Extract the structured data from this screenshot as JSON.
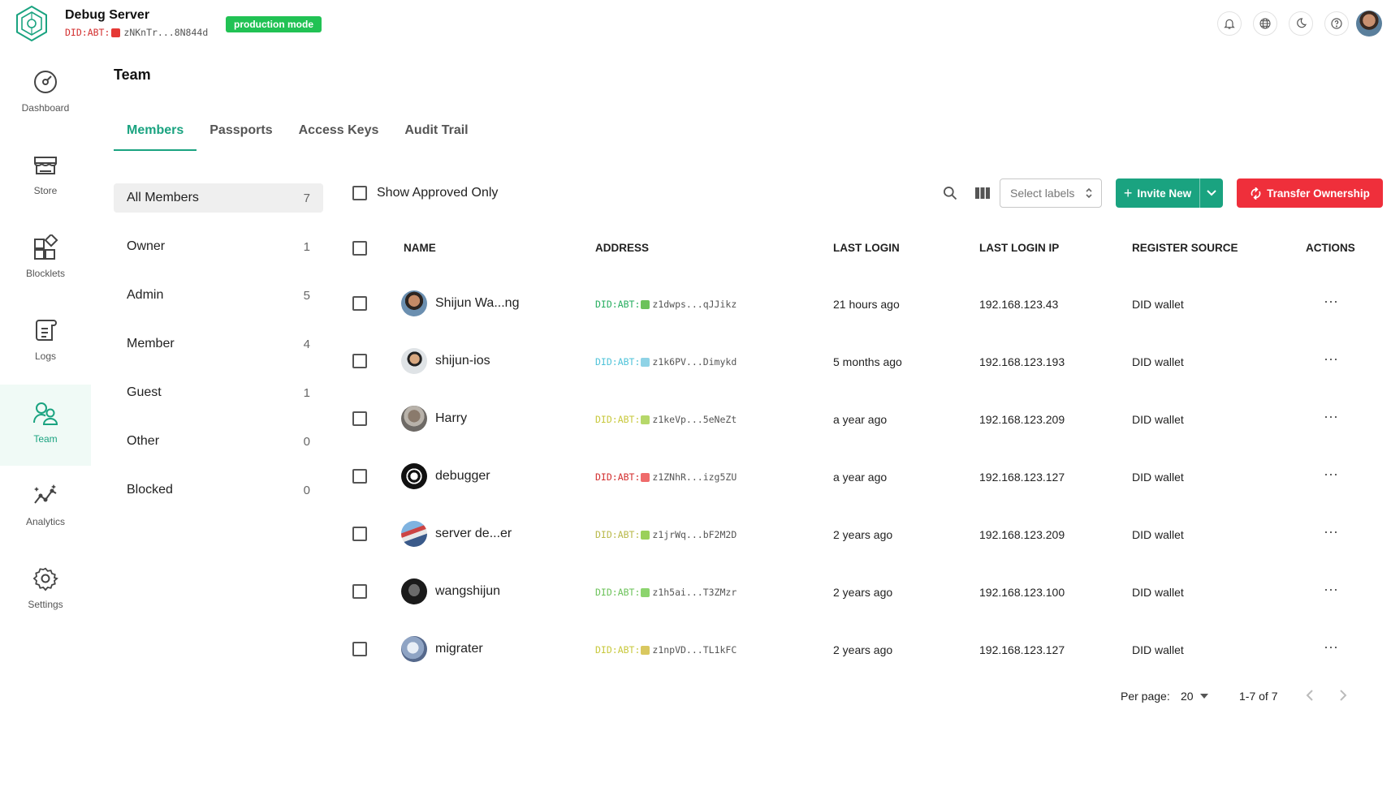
{
  "header": {
    "server_name": "Debug Server",
    "did_prefix": "DID:ABT:",
    "did_address": "zNKnTr...8N844d",
    "mode_badge": "production mode",
    "icons": [
      "bell-icon",
      "globe-icon",
      "moon-icon",
      "help-icon",
      "avatar"
    ]
  },
  "sidebar": {
    "items": [
      {
        "label": "Dashboard",
        "icon": "dashboard-icon"
      },
      {
        "label": "Store",
        "icon": "store-icon"
      },
      {
        "label": "Blocklets",
        "icon": "blocklets-icon"
      },
      {
        "label": "Logs",
        "icon": "logs-icon"
      },
      {
        "label": "Team",
        "icon": "team-icon",
        "active": true
      },
      {
        "label": "Analytics",
        "icon": "analytics-icon"
      },
      {
        "label": "Settings",
        "icon": "settings-icon"
      }
    ]
  },
  "page": {
    "title": "Team"
  },
  "tabs": [
    {
      "label": "Members",
      "active": true
    },
    {
      "label": "Passports"
    },
    {
      "label": "Access Keys"
    },
    {
      "label": "Audit Trail"
    }
  ],
  "filters": [
    {
      "label": "All Members",
      "count": "7",
      "active": true
    },
    {
      "label": "Owner",
      "count": "1"
    },
    {
      "label": "Admin",
      "count": "5"
    },
    {
      "label": "Member",
      "count": "4"
    },
    {
      "label": "Guest",
      "count": "1"
    },
    {
      "label": "Other",
      "count": "0"
    },
    {
      "label": "Blocked",
      "count": "0"
    }
  ],
  "toolbar": {
    "show_approved_label": "Show Approved Only",
    "select_labels_placeholder": "Select labels",
    "invite_label": "Invite New",
    "transfer_label": "Transfer Ownership"
  },
  "table": {
    "columns": [
      "NAME",
      "ADDRESS",
      "LAST LOGIN",
      "LAST LOGIN IP",
      "REGISTER SOURCE",
      "ACTIONS"
    ],
    "rows": [
      {
        "name": "Shijun Wa...ng",
        "did_prefix": "DID:ABT:",
        "address": "z1dwps...qJJikz",
        "last_login": "21 hours ago",
        "ip": "192.168.123.43",
        "source": "DID wallet",
        "actions": "⋯"
      },
      {
        "name": "shijun-ios",
        "did_prefix": "DID:ABT:",
        "address": "z1k6PV...Dimykd",
        "last_login": "5 months ago",
        "ip": "192.168.123.193",
        "source": "DID wallet",
        "actions": "⋯"
      },
      {
        "name": "Harry",
        "did_prefix": "DID:ABT:",
        "address": "z1keVp...5eNeZt",
        "last_login": "a year ago",
        "ip": "192.168.123.209",
        "source": "DID wallet",
        "actions": "⋯"
      },
      {
        "name": "debugger",
        "did_prefix": "DID:ABT:",
        "address": "z1ZNhR...izg5ZU",
        "last_login": "a year ago",
        "ip": "192.168.123.127",
        "source": "DID wallet",
        "actions": "⋯"
      },
      {
        "name": "server de...er",
        "did_prefix": "DID:ABT:",
        "address": "z1jrWq...bF2M2D",
        "last_login": "2 years ago",
        "ip": "192.168.123.209",
        "source": "DID wallet",
        "actions": "⋯"
      },
      {
        "name": "wangshijun",
        "did_prefix": "DID:ABT:",
        "address": "z1h5ai...T3ZMzr",
        "last_login": "2 years ago",
        "ip": "192.168.123.100",
        "source": "DID wallet",
        "actions": "⋯"
      },
      {
        "name": "migrater",
        "did_prefix": "DID:ABT:",
        "address": "z1npVD...TL1kFC",
        "last_login": "2 years ago",
        "ip": "192.168.123.127",
        "source": "DID wallet",
        "actions": "⋯"
      }
    ]
  },
  "pagination": {
    "per_page_label": "Per page:",
    "per_page_value": "20",
    "range": "1-7 of 7"
  },
  "colors": {
    "accent": "#1aa380",
    "badge": "#21c254",
    "danger": "#ef2f3b",
    "did_prefix": [
      "#27ae60",
      "#4fc3d9",
      "#c8c83c",
      "#d32f2f",
      "#b9b94a",
      "#6cc25a",
      "#c8c83c"
    ]
  }
}
